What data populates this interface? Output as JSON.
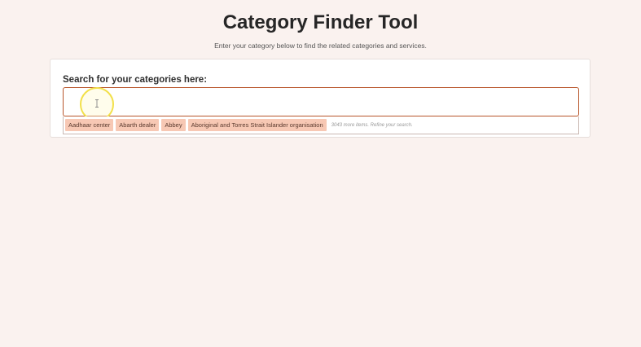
{
  "header": {
    "title": "Category Finder Tool",
    "subtitle": "Enter your category below to find the related categories and services."
  },
  "search": {
    "label": "Search for your categories here:",
    "value": "",
    "placeholder": ""
  },
  "results": {
    "chips": [
      "Aadhaar center",
      "Abarth dealer",
      "Abbey",
      "Aboriginal and Torres Strait Islander organisation"
    ],
    "more_note": "3043 more items. Refine your search."
  },
  "colors": {
    "background": "#faf2ef",
    "accent_border": "#b8562b",
    "chip_background": "#f7c8b4",
    "cursor_highlight": "#f2e04a"
  },
  "icons": {
    "text_cursor": "text-cursor-icon"
  }
}
